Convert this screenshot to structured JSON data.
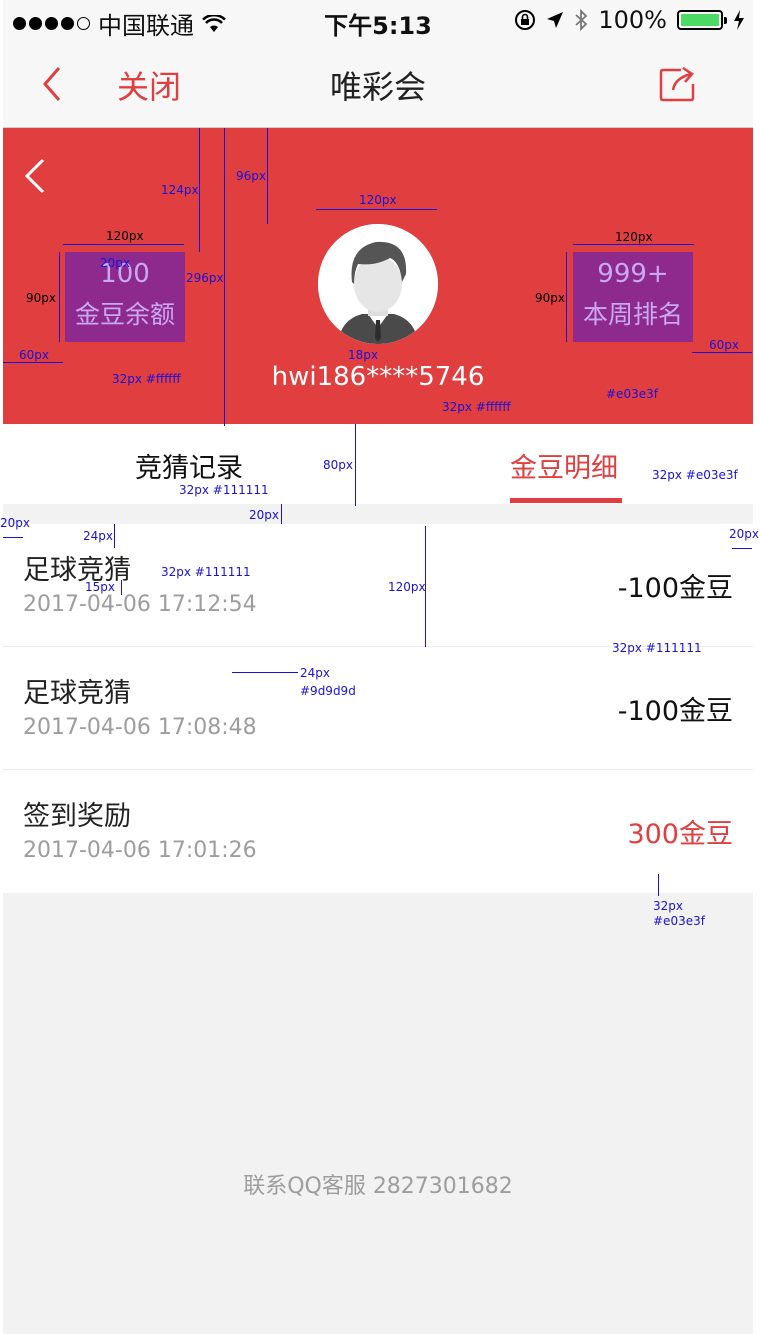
{
  "status_bar": {
    "carrier": "中国联通",
    "time": "下午5:13",
    "battery": "100%",
    "accent": "#4cd964"
  },
  "nav": {
    "back_icon": "chevron-left-icon",
    "close_label": "关闭",
    "title": "唯彩会",
    "share_icon": "share-icon"
  },
  "header": {
    "back_icon": "chevron-left-icon",
    "bg_color": "#e03e3f",
    "balance": {
      "value": "100",
      "label": "金豆余额"
    },
    "rank": {
      "value": "999+",
      "label": "本周排名"
    },
    "username": "hwi186****5746"
  },
  "tabs": [
    {
      "label": "竞猜记录",
      "active": false
    },
    {
      "label": "金豆明细",
      "active": true
    }
  ],
  "records": [
    {
      "title": "足球竞猜",
      "time": "2017-04-06 17:12:54",
      "amount": "-100金豆",
      "positive": false
    },
    {
      "title": "足球竞猜",
      "time": "2017-04-06 17:08:48",
      "amount": "-100金豆",
      "positive": false
    },
    {
      "title": "签到奖励",
      "time": "2017-04-06 17:01:26",
      "amount": "300金豆",
      "positive": true
    }
  ],
  "footer": "联系QQ客服 2827301682",
  "annotations": {
    "h124": "124px",
    "h296": "296px",
    "h96": "96px",
    "w120c": "120px",
    "w120l": "120px",
    "w120r": "120px",
    "p20": "20px",
    "h90l": "90px",
    "h90r": "90px",
    "m60l": "60px",
    "m60r": "60px",
    "f32white": "32px #ffffff",
    "g18": "18px",
    "f32white2": "32px #ffffff",
    "color_red": "#e03e3f",
    "h80": "80px",
    "f32dark": "32px #111111",
    "f32red": "32px #e03e3f",
    "gap20": "20px",
    "pad20l": "20px",
    "pad20r": "20px",
    "t24": "24px",
    "t15": "15px",
    "f32dark2": "32px #111111",
    "h120": "120px",
    "f32dark3": "32px #111111",
    "f24": "24px",
    "color_gray": "#9d9d9d",
    "f32": "32px",
    "color_red2": "#e03e3f"
  }
}
